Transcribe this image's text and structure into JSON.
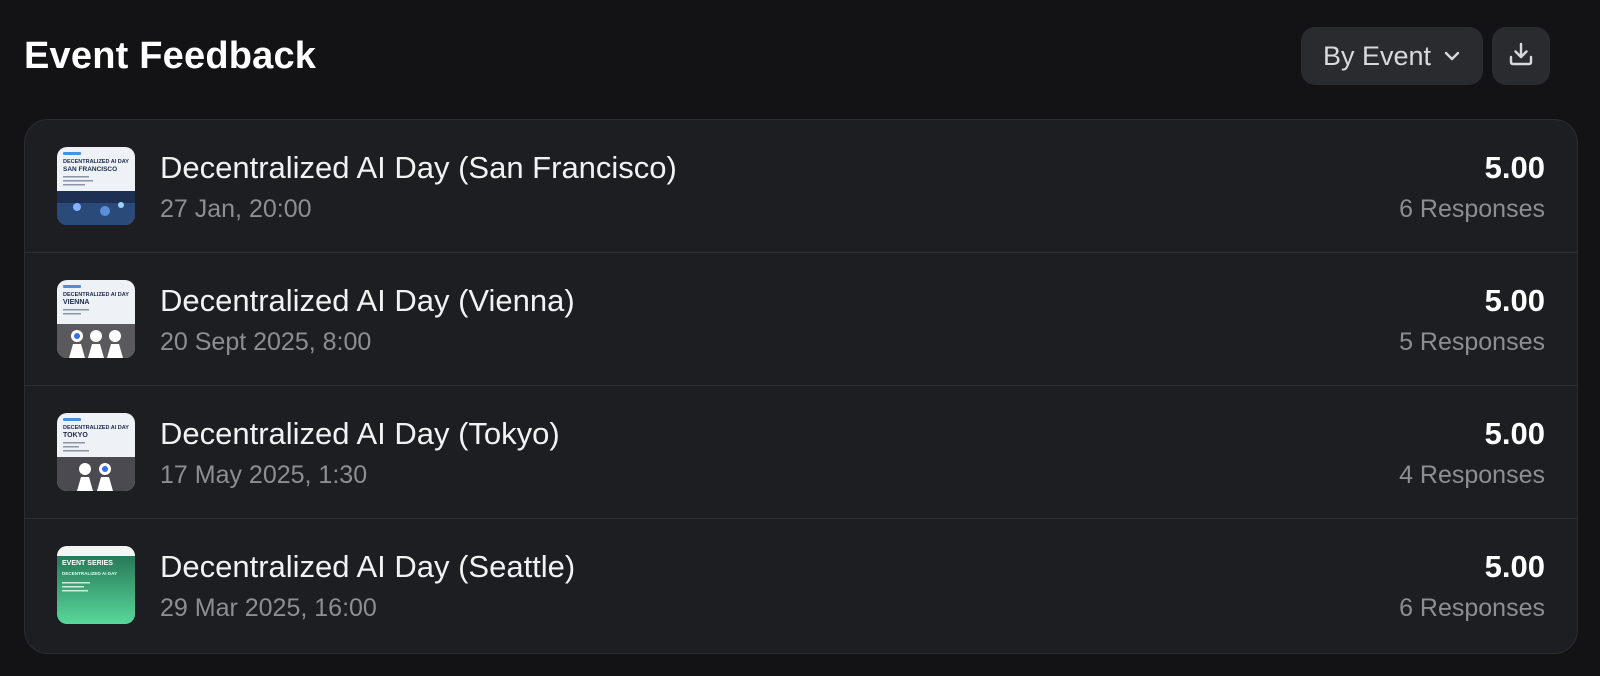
{
  "header": {
    "title": "Event Feedback",
    "group_select": {
      "value": "By Event",
      "icon": "chevron-down-icon"
    },
    "download": {
      "icon": "download-icon"
    }
  },
  "events": [
    {
      "title": "Decentralized AI Day (San Francisco)",
      "date": "27 Jan, 20:00",
      "score": "5.00",
      "responses": "6 Responses",
      "thumbnail": {
        "heading": "DECENTRALIZED AI DAY",
        "city": "SAN FRANCISCO"
      }
    },
    {
      "title": "Decentralized AI Day (Vienna)",
      "date": "20 Sept 2025, 8:00",
      "score": "5.00",
      "responses": "5 Responses",
      "thumbnail": {
        "heading": "DECENTRALIZED AI DAY",
        "city": "VIENNA"
      }
    },
    {
      "title": "Decentralized AI Day (Tokyo)",
      "date": "17 May 2025, 1:30",
      "score": "5.00",
      "responses": "4 Responses",
      "thumbnail": {
        "heading": "DECENTRALIZED AI DAY",
        "city": "TOKYO"
      }
    },
    {
      "title": "Decentralized AI Day (Seattle)",
      "date": "29 Mar 2025, 16:00",
      "score": "5.00",
      "responses": "6 Responses",
      "thumbnail": {
        "heading": "EVENT SERIES",
        "city": "DECENTRALIZED AI DAY"
      }
    }
  ],
  "colors": {
    "background": "#131315",
    "card": "#1d1e21",
    "button": "#2a2b2e",
    "muted_text": "#8d8e92",
    "seattle_thumb_green": "#2f8f6a"
  }
}
